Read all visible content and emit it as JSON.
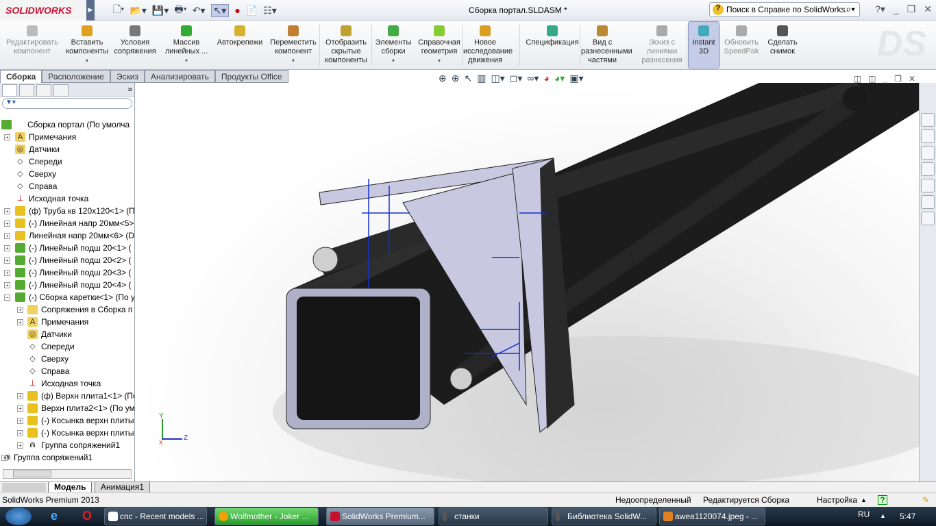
{
  "app": {
    "logo": "SOLIDWORKS",
    "window_title": "Сборка портал.SLDASM *"
  },
  "search": {
    "placeholder": "Поиск в Справке по SolidWorks"
  },
  "ribbon": [
    {
      "label": "Редактировать компонент",
      "disabled": true,
      "dropdown": false
    },
    {
      "label": "Вставить компоненты",
      "dropdown": true
    },
    {
      "label": "Условия сопряжения",
      "dropdown": false
    },
    {
      "label": "Массив линейных ...",
      "dropdown": true
    },
    {
      "label": "Автокрепежи",
      "dropdown": false
    },
    {
      "label": "Переместить компонент",
      "dropdown": true
    },
    {
      "label": "Отобразить скрытые компоненты",
      "dropdown": false
    },
    {
      "label": "Элементы сборки",
      "dropdown": true
    },
    {
      "label": "Справочная геометрия",
      "dropdown": true
    },
    {
      "label": "Новое исследование движения",
      "dropdown": false
    },
    {
      "label": "Спецификация",
      "dropdown": false
    },
    {
      "label": "Вид с разнесенными частями",
      "dropdown": false
    },
    {
      "label": "Эскиз с линиями разнесения",
      "disabled": true
    },
    {
      "label": "Instant 3D",
      "active": true
    },
    {
      "label": "Обновить SpeedPak",
      "disabled": true
    },
    {
      "label": "Сделать снимок"
    }
  ],
  "tabs": [
    "Сборка",
    "Расположение",
    "Эскиз",
    "Анализировать",
    "Продукты Office"
  ],
  "active_tab": "Сборка",
  "tree": [
    {
      "label": "Сборка портал  (По умолча",
      "level": 0,
      "icon": "assembly"
    },
    {
      "label": "Примечания",
      "level": 1,
      "icon": "annotations",
      "expand": true
    },
    {
      "label": "Датчики",
      "level": 1,
      "icon": "sensors"
    },
    {
      "label": "Спереди",
      "level": 1,
      "icon": "plane"
    },
    {
      "label": "Сверху",
      "level": 1,
      "icon": "plane"
    },
    {
      "label": "Справа",
      "level": 1,
      "icon": "plane"
    },
    {
      "label": "Исходная точка",
      "level": 1,
      "icon": "origin"
    },
    {
      "label": "(ф) Труба кв 120x120<1> (По",
      "level": 1,
      "icon": "part",
      "expand": true
    },
    {
      "label": "(-) Линейная напр 20мм<5>",
      "level": 1,
      "icon": "part",
      "expand": true
    },
    {
      "label": "Линейная напр 20мм<6> (D",
      "level": 1,
      "icon": "part",
      "expand": true
    },
    {
      "label": "(-) Линейный подш 20<1> (",
      "level": 1,
      "icon": "assembly",
      "expand": true
    },
    {
      "label": "(-) Линейный подш 20<2> (",
      "level": 1,
      "icon": "assembly",
      "expand": true
    },
    {
      "label": "(-) Линейный подш 20<3> (",
      "level": 1,
      "icon": "assembly",
      "expand": true
    },
    {
      "label": "(-) Линейный подш 20<4> (",
      "level": 1,
      "icon": "assembly",
      "expand": true
    },
    {
      "label": "(-) Сборка каретки<1> (По у",
      "level": 1,
      "icon": "assembly",
      "expand": true,
      "open": true
    },
    {
      "label": "Сопряжения в Сборка п",
      "level": 2,
      "icon": "mates",
      "expand": true
    },
    {
      "label": "Примечания",
      "level": 2,
      "icon": "annotations",
      "expand": true
    },
    {
      "label": "Датчики",
      "level": 2,
      "icon": "sensors"
    },
    {
      "label": "Спереди",
      "level": 2,
      "icon": "plane"
    },
    {
      "label": "Сверху",
      "level": 2,
      "icon": "plane"
    },
    {
      "label": "Справа",
      "level": 2,
      "icon": "plane"
    },
    {
      "label": "Исходная точка",
      "level": 2,
      "icon": "origin"
    },
    {
      "label": "(ф) Верхн плита1<1> (По",
      "level": 2,
      "icon": "part",
      "expand": true
    },
    {
      "label": "Верхн плита2<1> (По ум",
      "level": 2,
      "icon": "part",
      "expand": true
    },
    {
      "label": "(-) Косынка верхн плиты",
      "level": 2,
      "icon": "part",
      "expand": true
    },
    {
      "label": "(-) Косынка верхн плиты",
      "level": 2,
      "icon": "part",
      "expand": true
    },
    {
      "label": "Группа сопряжений1",
      "level": 2,
      "icon": "mategroup",
      "expand": true
    },
    {
      "label": "Группа сопряжений1",
      "level": 0,
      "icon": "mategroup",
      "expand": true
    }
  ],
  "triad": {
    "x": "X",
    "y": "Y",
    "z": "Z"
  },
  "bottom_tabs": [
    "Модель",
    "Анимация1"
  ],
  "status": {
    "product": "SolidWorks Premium 2013",
    "state": "Недоопределенный",
    "editing": "Редактируется Сборка",
    "custom": "Настройка"
  },
  "taskbar": {
    "items": [
      "cnc - Recent models ...",
      "Wolfmother - Joker ...",
      "SolidWorks Premium...",
      "станки",
      "Библиотека SolidW...",
      "awea1120074.jpeg - ..."
    ],
    "lang": "RU",
    "time": "5:47"
  }
}
